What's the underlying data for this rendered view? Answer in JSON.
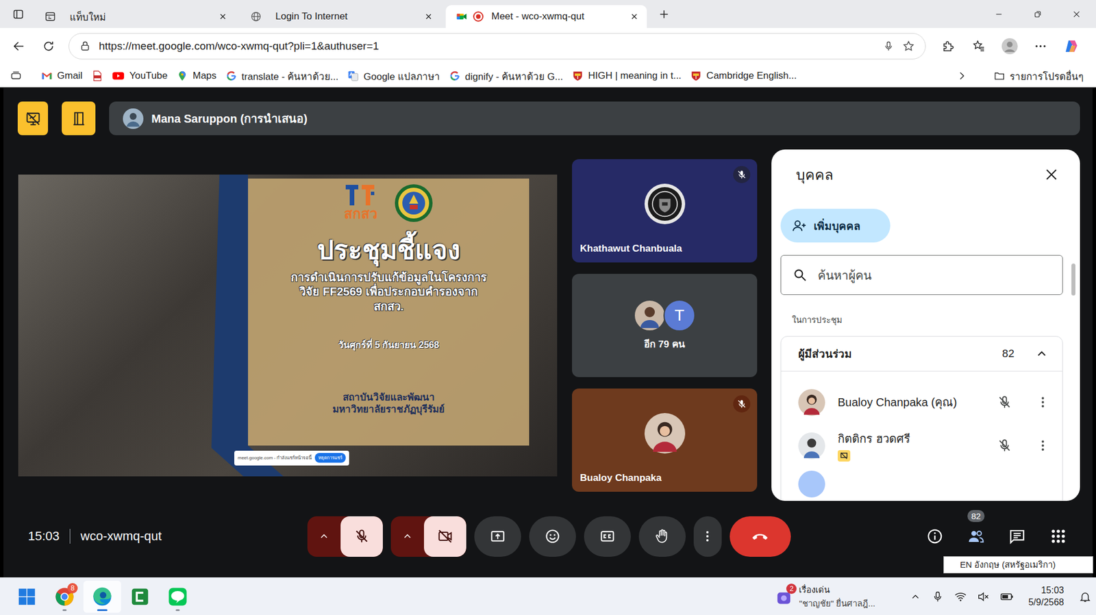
{
  "window": {
    "title": "Meet - wco-xwmq-qut"
  },
  "tabs": [
    {
      "label": "แท็บใหม่",
      "kind": "newtab",
      "selected": false,
      "recording": false
    },
    {
      "label": "Login To Internet",
      "kind": "web",
      "selected": false,
      "recording": false
    },
    {
      "label": "Meet - wco-xwmq-qut",
      "kind": "meet",
      "selected": true,
      "recording": true
    }
  ],
  "address": {
    "url": "https://meet.google.com/wco-xwmq-qut?pli=1&authuser=1"
  },
  "bookmarks": [
    {
      "label": "Gmail",
      "kind": "gmail"
    },
    {
      "label": "",
      "kind": "pdf"
    },
    {
      "label": "YouTube",
      "kind": "youtube"
    },
    {
      "label": "Maps",
      "kind": "maps"
    },
    {
      "label": "translate - ค้นหาด้วย...",
      "kind": "google"
    },
    {
      "label": "Google แปลภาษา",
      "kind": "gtranslate"
    },
    {
      "label": "dignify - ค้นหาด้วย G...",
      "kind": "google"
    },
    {
      "label": "HIGH | meaning in t...",
      "kind": "cambridge"
    },
    {
      "label": "Cambridge English...",
      "kind": "cambridge"
    }
  ],
  "other_bookmarks": "รายการโปรดอื่นๆ",
  "meet": {
    "presenter": "Mana Saruppon (การนำเสนอ)",
    "time": "15:03",
    "code": "wco-xwmq-qut",
    "people_badge": "82"
  },
  "slide": {
    "logo_text": "สกสว",
    "title": "ประชุมชี้แจง",
    "subtitle_lines": [
      "การดำเนินการปรับแก้ข้อมูลในโครงการ",
      "วิจัย FF2569 เพื่อประกอบคำรองจาก",
      "สกสว."
    ],
    "date": "วันศุกร์ที่ 5 กันยายน 2568",
    "org_lines": [
      "สถาบันวิจัยและพัฒนา",
      "มหาวิทยาลัยราชภัฏบุรีรัมย์"
    ],
    "share_bar": {
      "text": "meet.google.com - กำลังแชร์หน้าจอนี้",
      "button": "หยุดการแชร์"
    }
  },
  "tiles": [
    {
      "kind": "avatar",
      "name": "Khathawut Chanbuala",
      "muted": true,
      "initial": "",
      "color": "#262a66"
    },
    {
      "kind": "group",
      "name": "อีก 79 คน",
      "muted": false,
      "initial": "T",
      "color": "#3c4043"
    },
    {
      "kind": "avatar",
      "name": "Bualoy Chanpaka",
      "muted": true,
      "initial": "",
      "color": "#6e3a1e"
    }
  ],
  "panel": {
    "title": "บุคคล",
    "add_button": "เพิ่มบุคคล",
    "search_placeholder": "ค้นหาผู้คน",
    "section": "ในการประชุม",
    "group": {
      "label": "ผู้มีส่วนร่วม",
      "count": "82",
      "expanded": true
    },
    "participants": [
      {
        "name": "Bualoy Chanpaka (คุณ)",
        "muted": true,
        "presenting": false
      },
      {
        "name": "กิตติกร ฮวดศรี",
        "muted": true,
        "presenting": true
      }
    ]
  },
  "controls": {
    "mic_off": true,
    "camera_off": true
  },
  "language_popup": "EN อังกฤษ (สหรัฐอเมริกา)",
  "taskbar": {
    "apps": [
      {
        "kind": "start",
        "badge": "",
        "running": false,
        "active": false
      },
      {
        "kind": "chrome",
        "badge": "8",
        "running": true,
        "active": false
      },
      {
        "kind": "edge",
        "badge": "",
        "running": true,
        "active": true
      },
      {
        "kind": "camtasia",
        "badge": "",
        "running": false,
        "active": false
      },
      {
        "kind": "line",
        "badge": "",
        "running": true,
        "active": false
      }
    ],
    "news": {
      "badge": "2",
      "title": "เรื่องเด่น",
      "headline": "\"ชาญชัย\" ยื่นศาลฎี..."
    },
    "sound_muted": true,
    "time": "15:03",
    "date": "5/9/2568"
  }
}
